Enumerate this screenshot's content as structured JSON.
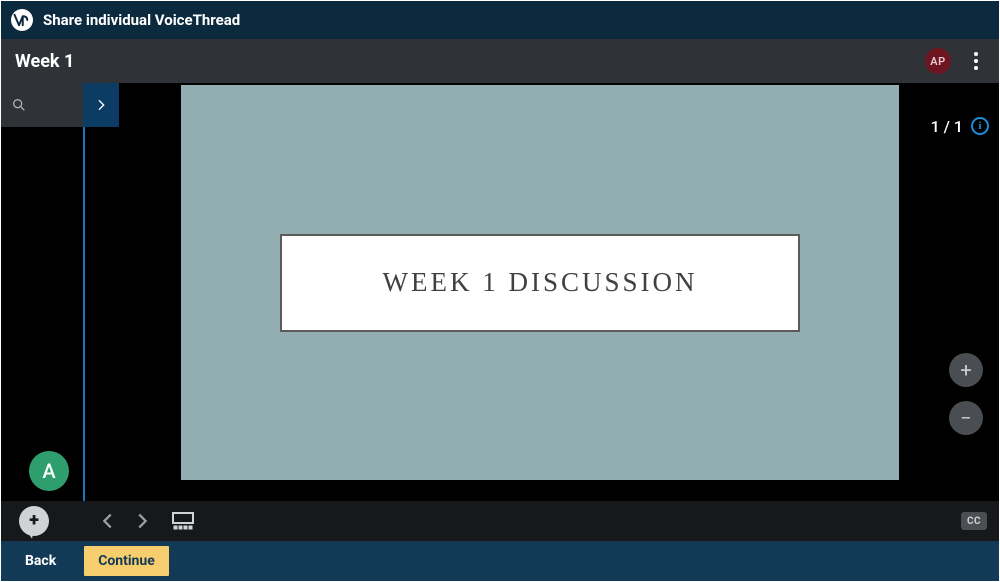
{
  "topbar": {
    "logo_text": "vt",
    "title": "Share individual VoiceThread"
  },
  "subheader": {
    "title": "Week 1",
    "avatar_initials": "AP"
  },
  "slide": {
    "title": "WEEK 1 DISCUSSION"
  },
  "page": {
    "indicator": "1 / 1",
    "info_glyph": "i"
  },
  "zoom": {
    "plus": "+",
    "minus": "−"
  },
  "commenter": {
    "initial": "A"
  },
  "playbar": {
    "add_glyph": "+",
    "cc_label": "CC"
  },
  "footer": {
    "back": "Back",
    "continue": "Continue"
  }
}
